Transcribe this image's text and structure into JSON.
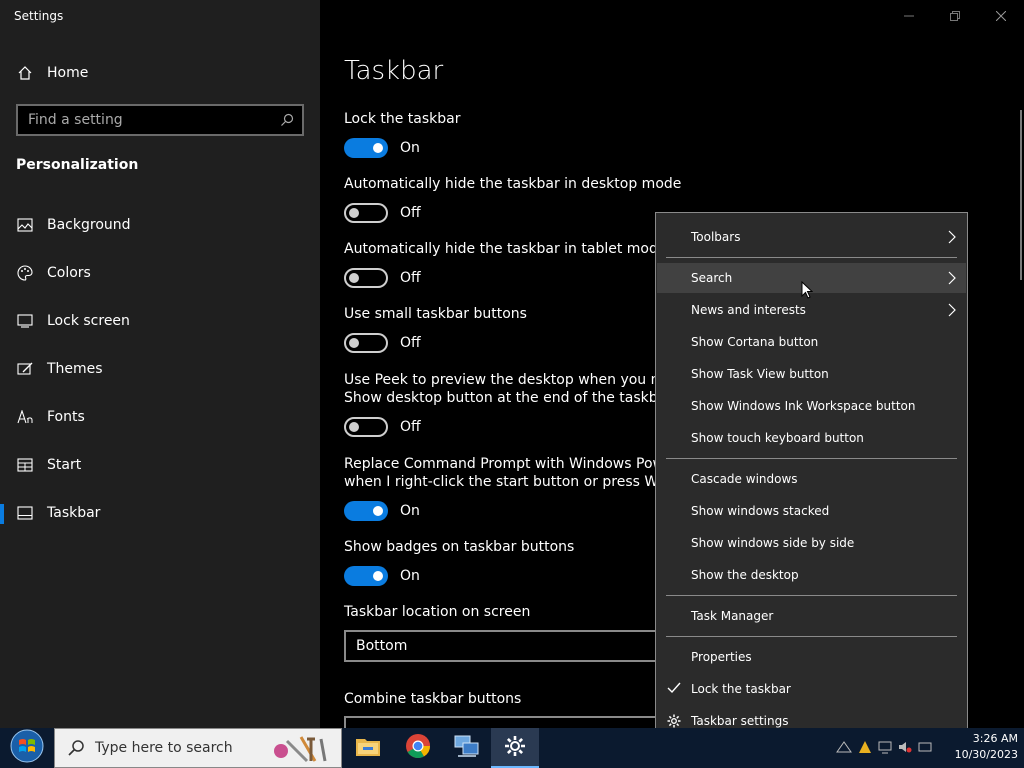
{
  "window": {
    "title": "Settings",
    "controls": [
      "minimize-icon",
      "restore-icon",
      "close-icon"
    ]
  },
  "sidebar": {
    "home_label": "Home",
    "search_placeholder": "Find a setting",
    "section_title": "Personalization",
    "items": [
      {
        "label": "Background",
        "icon": "image-icon"
      },
      {
        "label": "Colors",
        "icon": "palette-icon"
      },
      {
        "label": "Lock screen",
        "icon": "monitor-icon"
      },
      {
        "label": "Themes",
        "icon": "brush-icon"
      },
      {
        "label": "Fonts",
        "icon": "font-icon"
      },
      {
        "label": "Start",
        "icon": "grid-icon"
      },
      {
        "label": "Taskbar",
        "icon": "taskbar-icon",
        "selected": true
      }
    ]
  },
  "main": {
    "title": "Taskbar",
    "settings": [
      {
        "label": "Lock the taskbar",
        "state": "On"
      },
      {
        "label": "Automatically hide the taskbar in desktop mode",
        "state": "Off"
      },
      {
        "label": "Automatically hide the taskbar in tablet mode",
        "state": "Off"
      },
      {
        "label": "Use small taskbar buttons",
        "state": "Off"
      },
      {
        "label": "Use Peek to preview the desktop when you move y",
        "label2": "Show desktop button at the end of the taskbar",
        "state": "Off"
      },
      {
        "label": "Replace Command Prompt with Windows PowerSh",
        "label2": "when I right-click the start button or press Window",
        "state": "On"
      },
      {
        "label": "Show badges on taskbar buttons",
        "state": "On"
      }
    ],
    "location_label": "Taskbar location on screen",
    "location_value": "Bottom",
    "combine_label": "Combine taskbar buttons"
  },
  "context_menu": {
    "items": [
      {
        "label": "Toolbars",
        "submenu": true
      },
      {
        "label": "Search",
        "submenu": true
      },
      {
        "label": "News and interests",
        "submenu": true
      },
      {
        "label": "Show Cortana button"
      },
      {
        "label": "Show Task View button"
      },
      {
        "label": "Show Windows Ink Workspace button"
      },
      {
        "label": "Show touch keyboard button"
      },
      {
        "label": "Cascade windows"
      },
      {
        "label": "Show windows stacked"
      },
      {
        "label": "Show windows side by side"
      },
      {
        "label": "Show the desktop"
      },
      {
        "label": "Task Manager"
      },
      {
        "label": "Properties"
      },
      {
        "label": "Lock the taskbar",
        "checked": true
      },
      {
        "label": "Taskbar settings",
        "icon": "gear-icon"
      }
    ]
  },
  "taskbar": {
    "search_placeholder": "Type here to search",
    "apps": [
      "file-explorer-icon",
      "chrome-icon",
      "network-app-icon",
      "settings-app-icon"
    ],
    "time": "3:26 AM",
    "date": "10/30/2023"
  },
  "colors": {
    "accent": "#0a7ce0",
    "sidebar_bg": "#1f1f1f",
    "menu_bg": "#2b2b2b"
  }
}
